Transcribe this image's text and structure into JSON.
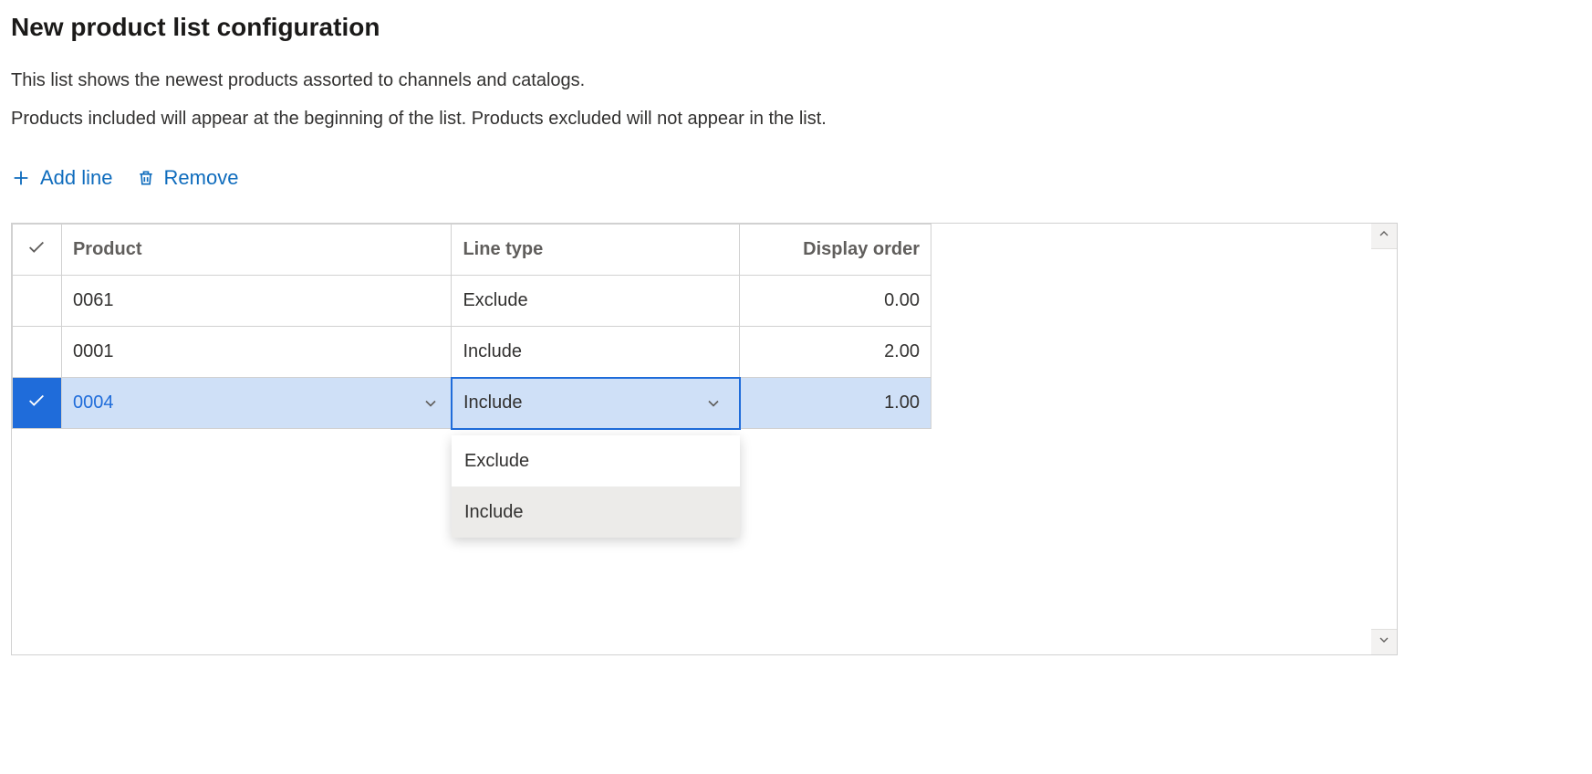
{
  "header": {
    "title": "New product list configuration",
    "desc1": "This list shows the newest products assorted to channels and catalogs.",
    "desc2": "Products included will appear at the beginning of the list. Products excluded will not appear in the list."
  },
  "toolbar": {
    "add_line": "Add line",
    "remove": "Remove"
  },
  "grid": {
    "columns": {
      "product": "Product",
      "line_type": "Line type",
      "display_order": "Display order"
    },
    "rows": [
      {
        "selected": false,
        "product": "0061",
        "line_type": "Exclude",
        "display_order": "0.00"
      },
      {
        "selected": false,
        "product": "0001",
        "line_type": "Include",
        "display_order": "2.00"
      },
      {
        "selected": true,
        "product": "0004",
        "line_type": "Include",
        "display_order": "1.00"
      }
    ]
  },
  "dropdown": {
    "options": [
      "Exclude",
      "Include"
    ],
    "hovered": "Include"
  }
}
